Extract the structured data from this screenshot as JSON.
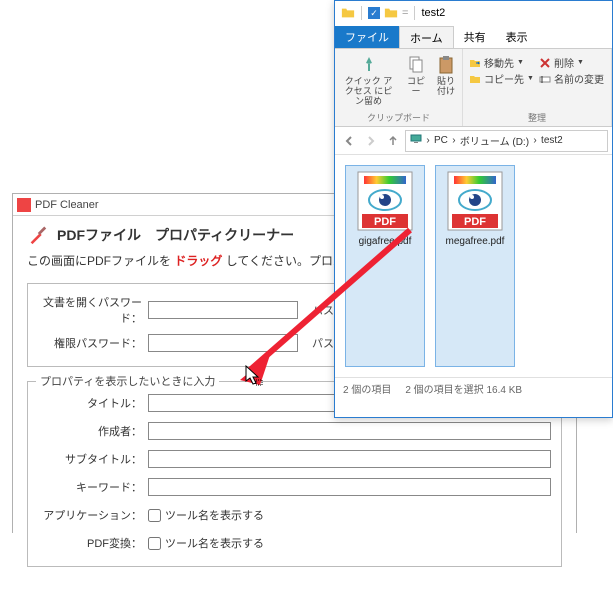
{
  "pdf": {
    "title": "PDF Cleaner",
    "heading": "PDFファイル　プロパティクリーナー",
    "note_pre": "この画面にPDFファイルを ",
    "note_drag": "ドラッグ",
    "note_post": " してください。プロパティがクリア",
    "g1": {
      "label": "",
      "r1_label": "文書を開くパスワード：",
      "r1_val": "",
      "r1_hint": "パスワードが設定さ",
      "r2_label": "権限パスワード：",
      "r2_val": "",
      "r2_hint": "パスワードが設定さ"
    },
    "g2": {
      "label": "プロパティを表示したいときに入力",
      "title_label": "タイトル：",
      "title_val": "",
      "author_label": "作成者：",
      "author_val": "",
      "subtitle_label": "サブタイトル：",
      "subtitle_val": "",
      "keyword_label": "キーワード：",
      "keyword_val": "",
      "app_label": "アプリケーション：",
      "app_cb": "ツール名を表示する",
      "conv_label": "PDF変換：",
      "conv_cb": "ツール名を表示する"
    }
  },
  "explorer": {
    "title": "test2",
    "tabs": {
      "file": "ファイル",
      "home": "ホーム",
      "share": "共有",
      "view": "表示"
    },
    "ribbon": {
      "pin": "クイック アクセス\nにピン留め",
      "copy": "コピー",
      "paste": "貼り付け",
      "group1_label": "クリップボード",
      "move_to": "移動先",
      "copy_to": "コピー先",
      "delete": "削除",
      "rename": "名前の変更",
      "group2_label": "整理"
    },
    "addr": {
      "pc": "PC",
      "vol": "ボリューム (D:)",
      "folder": "test2"
    },
    "files": [
      {
        "name": "gigafree.pdf"
      },
      {
        "name": "megafree.pdf"
      }
    ],
    "status": {
      "count": "2 個の項目",
      "sel": "2 個の項目を選択  16.4 KB"
    }
  }
}
